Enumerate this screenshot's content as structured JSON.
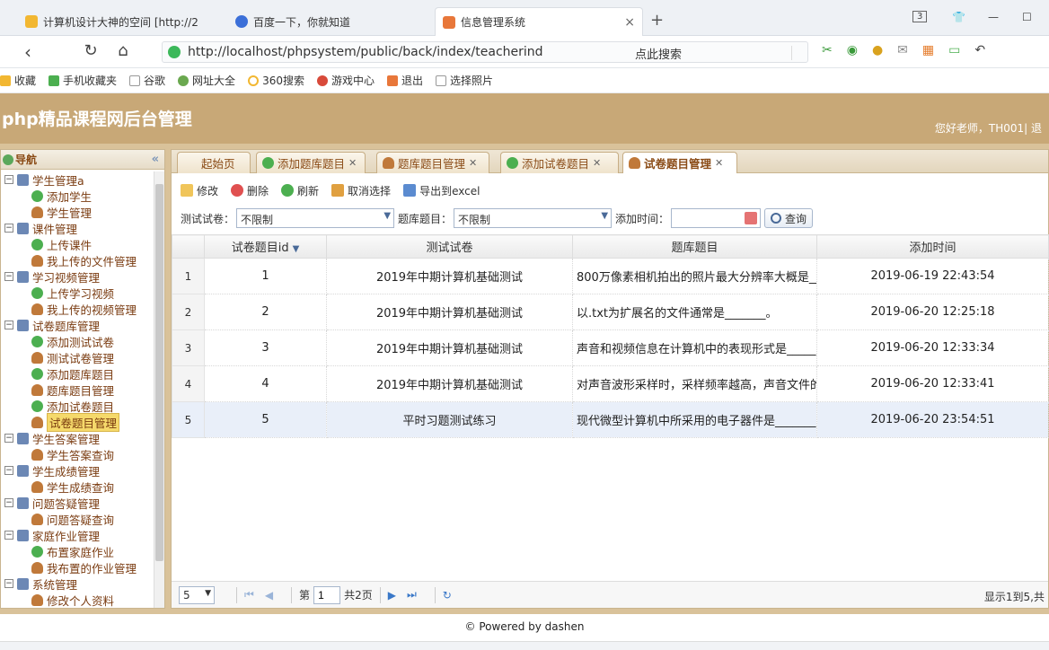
{
  "browser": {
    "tabs": [
      {
        "title": "计算机设计大神的空间 [http://2"
      },
      {
        "title": "百度一下，你就知道"
      },
      {
        "title": "信息管理系统"
      }
    ],
    "tab_close": "×",
    "new_tab": "+",
    "badge_count": "3",
    "url": "http://localhost/phpsystem/public/back/index/teacherind",
    "search_placeholder": "点此搜索",
    "bookmarks": [
      {
        "label": "收藏"
      },
      {
        "label": "手机收藏夹"
      },
      {
        "label": "谷歌"
      },
      {
        "label": "网址大全"
      },
      {
        "label": "360搜索"
      },
      {
        "label": "游戏中心"
      },
      {
        "label": "退出"
      },
      {
        "label": "选择照片"
      }
    ]
  },
  "app": {
    "title": "php精品课程网后台管理",
    "greeting": "您好老师，TH001| 退"
  },
  "sidebar": {
    "heading": "导航",
    "collapse_glyph": "«",
    "tree": [
      {
        "label": "学生管理a",
        "level": 1,
        "icon": "folder-icon"
      },
      {
        "label": "添加学生",
        "level": 2,
        "icon": "add-icon"
      },
      {
        "label": "学生管理",
        "level": 2,
        "icon": "user-icon"
      },
      {
        "label": "课件管理",
        "level": 1,
        "icon": "folder-icon"
      },
      {
        "label": "上传课件",
        "level": 2,
        "icon": "add-icon"
      },
      {
        "label": "我上传的文件管理",
        "level": 2,
        "icon": "user-icon"
      },
      {
        "label": "学习视频管理",
        "level": 1,
        "icon": "folder-icon"
      },
      {
        "label": "上传学习视频",
        "level": 2,
        "icon": "add-icon"
      },
      {
        "label": "我上传的视频管理",
        "level": 2,
        "icon": "user-icon"
      },
      {
        "label": "试卷题库管理",
        "level": 1,
        "icon": "folder-icon"
      },
      {
        "label": "添加测试试卷",
        "level": 2,
        "icon": "add-icon"
      },
      {
        "label": "测试试卷管理",
        "level": 2,
        "icon": "user-icon"
      },
      {
        "label": "添加题库题目",
        "level": 2,
        "icon": "add-icon"
      },
      {
        "label": "题库题目管理",
        "level": 2,
        "icon": "user-icon"
      },
      {
        "label": "添加试卷题目",
        "level": 2,
        "icon": "add-icon"
      },
      {
        "label": "试卷题目管理",
        "level": 2,
        "icon": "user-icon",
        "selected": true
      },
      {
        "label": "学生答案管理",
        "level": 1,
        "icon": "folder-icon"
      },
      {
        "label": "学生答案查询",
        "level": 2,
        "icon": "user-icon"
      },
      {
        "label": "学生成绩管理",
        "level": 1,
        "icon": "folder-icon"
      },
      {
        "label": "学生成绩查询",
        "level": 2,
        "icon": "user-icon"
      },
      {
        "label": "问题答疑管理",
        "level": 1,
        "icon": "folder-icon"
      },
      {
        "label": "问题答疑查询",
        "level": 2,
        "icon": "user-icon"
      },
      {
        "label": "家庭作业管理",
        "level": 1,
        "icon": "folder-icon"
      },
      {
        "label": "布置家庭作业",
        "level": 2,
        "icon": "add-icon"
      },
      {
        "label": "我布置的作业管理",
        "level": 2,
        "icon": "user-icon"
      },
      {
        "label": "系统管理",
        "level": 1,
        "icon": "folder-icon"
      },
      {
        "label": "修改个人资料",
        "level": 2,
        "icon": "edit-icon"
      }
    ]
  },
  "main": {
    "tabs": [
      {
        "label": "起始页",
        "closable": false
      },
      {
        "label": "添加题库题目",
        "closable": true
      },
      {
        "label": "题库题目管理",
        "closable": true
      },
      {
        "label": "添加试卷题目",
        "closable": true
      },
      {
        "label": "试卷题目管理",
        "closable": true,
        "active": true
      }
    ],
    "toolbar": {
      "edit": "修改",
      "delete": "删除",
      "refresh": "刷新",
      "deselect": "取消选择",
      "export": "导出到excel"
    },
    "filters": {
      "paper_label": "测试试卷：",
      "paper_value": "不限制",
      "question_label": "题库题目：",
      "question_value": "不限制",
      "time_label": "添加时间：",
      "time_value": "",
      "query_button": "查询"
    },
    "grid": {
      "columns": [
        "试卷题目id",
        "测试试卷",
        "题库题目",
        "添加时间"
      ],
      "rows": [
        {
          "rn": "1",
          "id": "1",
          "paper": "2019年中期计算机基础测试",
          "question": "800万像素相机拍出的照片最大分辨率大概是__",
          "time": "2019-06-19 22:43:54"
        },
        {
          "rn": "2",
          "id": "2",
          "paper": "2019年中期计算机基础测试",
          "question": "以.txt为扩展名的文件通常是_______。",
          "time": "2019-06-20 12:25:18"
        },
        {
          "rn": "3",
          "id": "3",
          "paper": "2019年中期计算机基础测试",
          "question": "声音和视频信息在计算机中的表现形式是_____",
          "time": "2019-06-20 12:33:34"
        },
        {
          "rn": "4",
          "id": "4",
          "paper": "2019年中期计算机基础测试",
          "question": "对声音波形采样时，采样频率越高，声音文件的",
          "time": "2019-06-20 12:33:41"
        },
        {
          "rn": "5",
          "id": "5",
          "paper": "平时习题测试练习",
          "question": "现代微型计算机中所采用的电子器件是_______",
          "time": "2019-06-20 23:54:51"
        }
      ]
    },
    "pager": {
      "page_size": "5",
      "page_prefix": "第",
      "current_page": "1",
      "total_pages": "共2页",
      "info": "显示1到5,共"
    }
  },
  "footer": {
    "text": "© Powered by dashen"
  },
  "colors": {
    "header_bg": "#c8a877",
    "frame_bg": "#d9c29a",
    "accent_text": "#8a4b16"
  }
}
